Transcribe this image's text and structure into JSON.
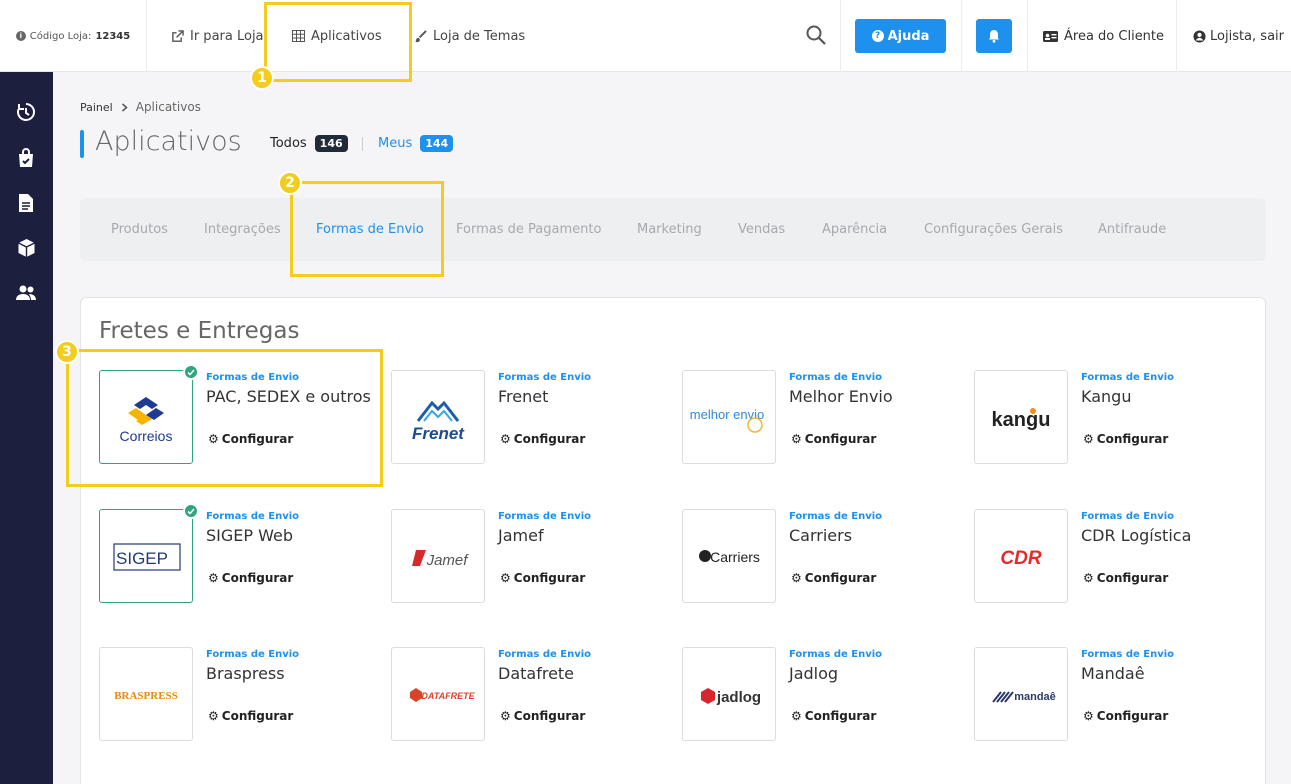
{
  "topbar": {
    "store_code_label": "Código Loja:",
    "store_code_value": "12345",
    "nav": [
      {
        "label": "Ir para Loja",
        "icon": "external-link-icon"
      },
      {
        "label": "Aplicativos",
        "icon": "grid-icon"
      },
      {
        "label": "Loja de Temas",
        "icon": "brush-icon"
      }
    ],
    "help_label": "Ajuda",
    "client_area_label": "Área do Cliente",
    "user_label": "Lojista, sair"
  },
  "colors": {
    "accent": "#1e90ee",
    "sidebar": "#1c1f3e",
    "installed": "#2ea57a",
    "highlight": "#f2cc1f"
  },
  "breadcrumb": {
    "home": "Painel",
    "current": "Aplicativos"
  },
  "page": {
    "title": "Aplicativos",
    "filters": [
      {
        "label": "Todos",
        "count": "146"
      },
      {
        "label": "Meus",
        "count": "144"
      }
    ]
  },
  "categories": [
    "Produtos",
    "Integrações",
    "Formas de Envio",
    "Formas de Pagamento",
    "Marketing",
    "Vendas",
    "Aparência",
    "Configurações Gerais",
    "Antifraude"
  ],
  "active_category": "Formas de Envio",
  "section_title": "Fretes e Entregas",
  "configure_label": "Configurar",
  "apps": [
    {
      "category": "Formas de Envio",
      "name": "PAC, SEDEX e outros",
      "logo": "Correios",
      "installed": true
    },
    {
      "category": "Formas de Envio",
      "name": "Frenet",
      "logo": "Frenet",
      "installed": false
    },
    {
      "category": "Formas de Envio",
      "name": "Melhor Envio",
      "logo": "melhor envio",
      "installed": false
    },
    {
      "category": "Formas de Envio",
      "name": "Kangu",
      "logo": "kangu",
      "installed": false
    },
    {
      "category": "Formas de Envio",
      "name": "SIGEP Web",
      "logo": "SIGEP",
      "installed": true
    },
    {
      "category": "Formas de Envio",
      "name": "Jamef",
      "logo": "Jamef",
      "installed": false
    },
    {
      "category": "Formas de Envio",
      "name": "Carriers",
      "logo": "Carriers",
      "installed": false
    },
    {
      "category": "Formas de Envio",
      "name": "CDR Logística",
      "logo": "CDR",
      "installed": false
    },
    {
      "category": "Formas de Envio",
      "name": "Braspress",
      "logo": "BRASPRESS",
      "installed": false
    },
    {
      "category": "Formas de Envio",
      "name": "Datafrete",
      "logo": "DATAFRETE",
      "installed": false
    },
    {
      "category": "Formas de Envio",
      "name": "Jadlog",
      "logo": "jadlog",
      "installed": false
    },
    {
      "category": "Formas de Envio",
      "name": "Mandaê",
      "logo": "mandaê",
      "installed": false
    }
  ],
  "annotations": [
    "1",
    "2",
    "3"
  ]
}
